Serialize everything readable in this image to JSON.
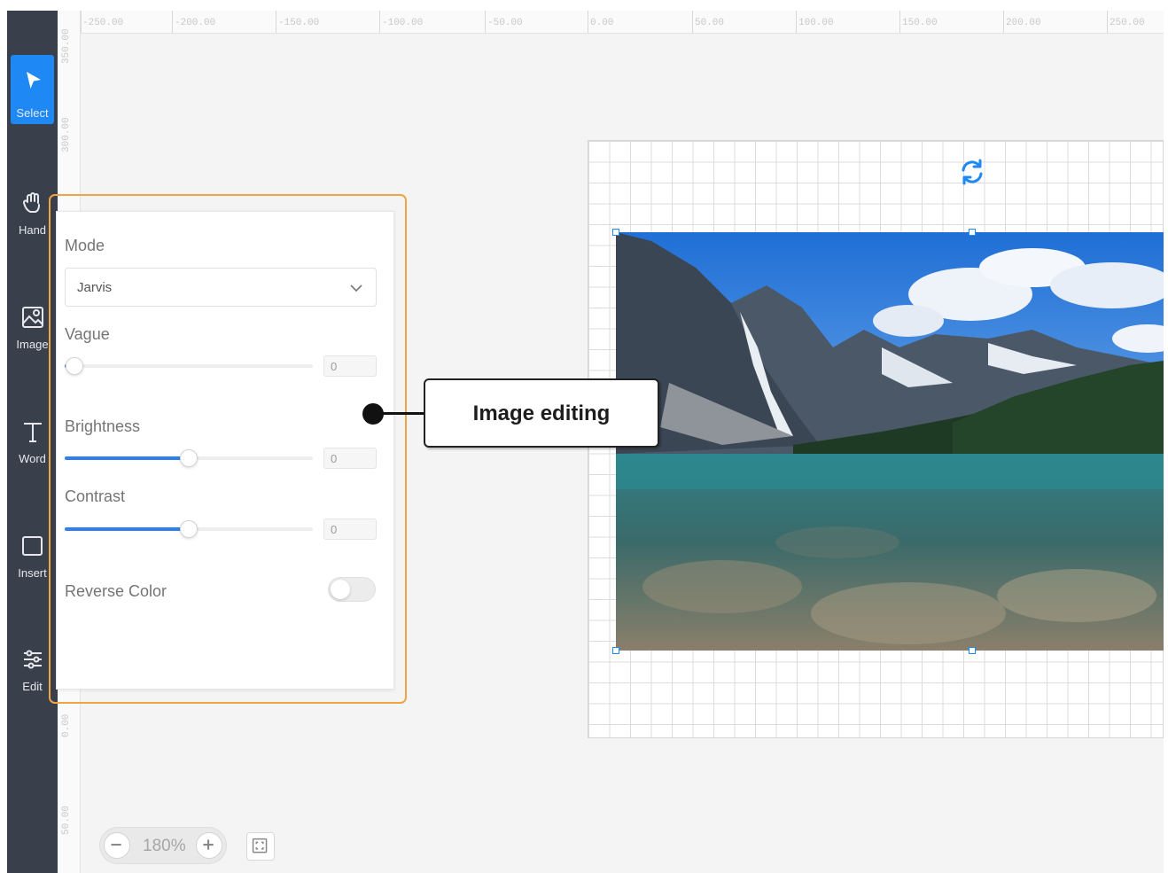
{
  "toolbar": {
    "items": [
      {
        "label": "Select",
        "icon": "cursor-arrow-icon",
        "active": true
      },
      {
        "label": "Hand",
        "icon": "hand-icon"
      },
      {
        "label": "Image",
        "icon": "image-icon"
      },
      {
        "label": "Word",
        "icon": "text-icon"
      },
      {
        "label": "Insert",
        "icon": "shape-icon"
      },
      {
        "label": "Edit",
        "icon": "sliders-icon"
      }
    ],
    "active_color": "#1e88f5"
  },
  "ruler": {
    "top_ticks": [
      "-250.00",
      "-200.00",
      "-150.00",
      "-100.00",
      "-50.00",
      "0.00",
      "50.00",
      "100.00",
      "150.00",
      "200.00",
      "250.00"
    ],
    "left_ticks": [
      "350.00",
      "300.00",
      "0.00",
      "50.00"
    ]
  },
  "panel": {
    "mode_label": "Mode",
    "mode_value": "Jarvis",
    "vague_label": "Vague",
    "vague_value": "0",
    "vague_level": 0.04,
    "brightness_label": "Brightness",
    "brightness_value": "0",
    "brightness_level": 0.5,
    "contrast_label": "Contrast",
    "contrast_value": "0",
    "contrast_level": 0.5,
    "reverse_label": "Reverse Color",
    "reverse_on": false,
    "accent_color": "#2f7ff0",
    "outline_color": "#f0a544"
  },
  "callout": {
    "text": "Image editing"
  },
  "zoom": {
    "value": "180%",
    "minus_icon": "minus-icon",
    "plus_icon": "plus-icon",
    "fit_icon": "fit-screen-icon"
  }
}
